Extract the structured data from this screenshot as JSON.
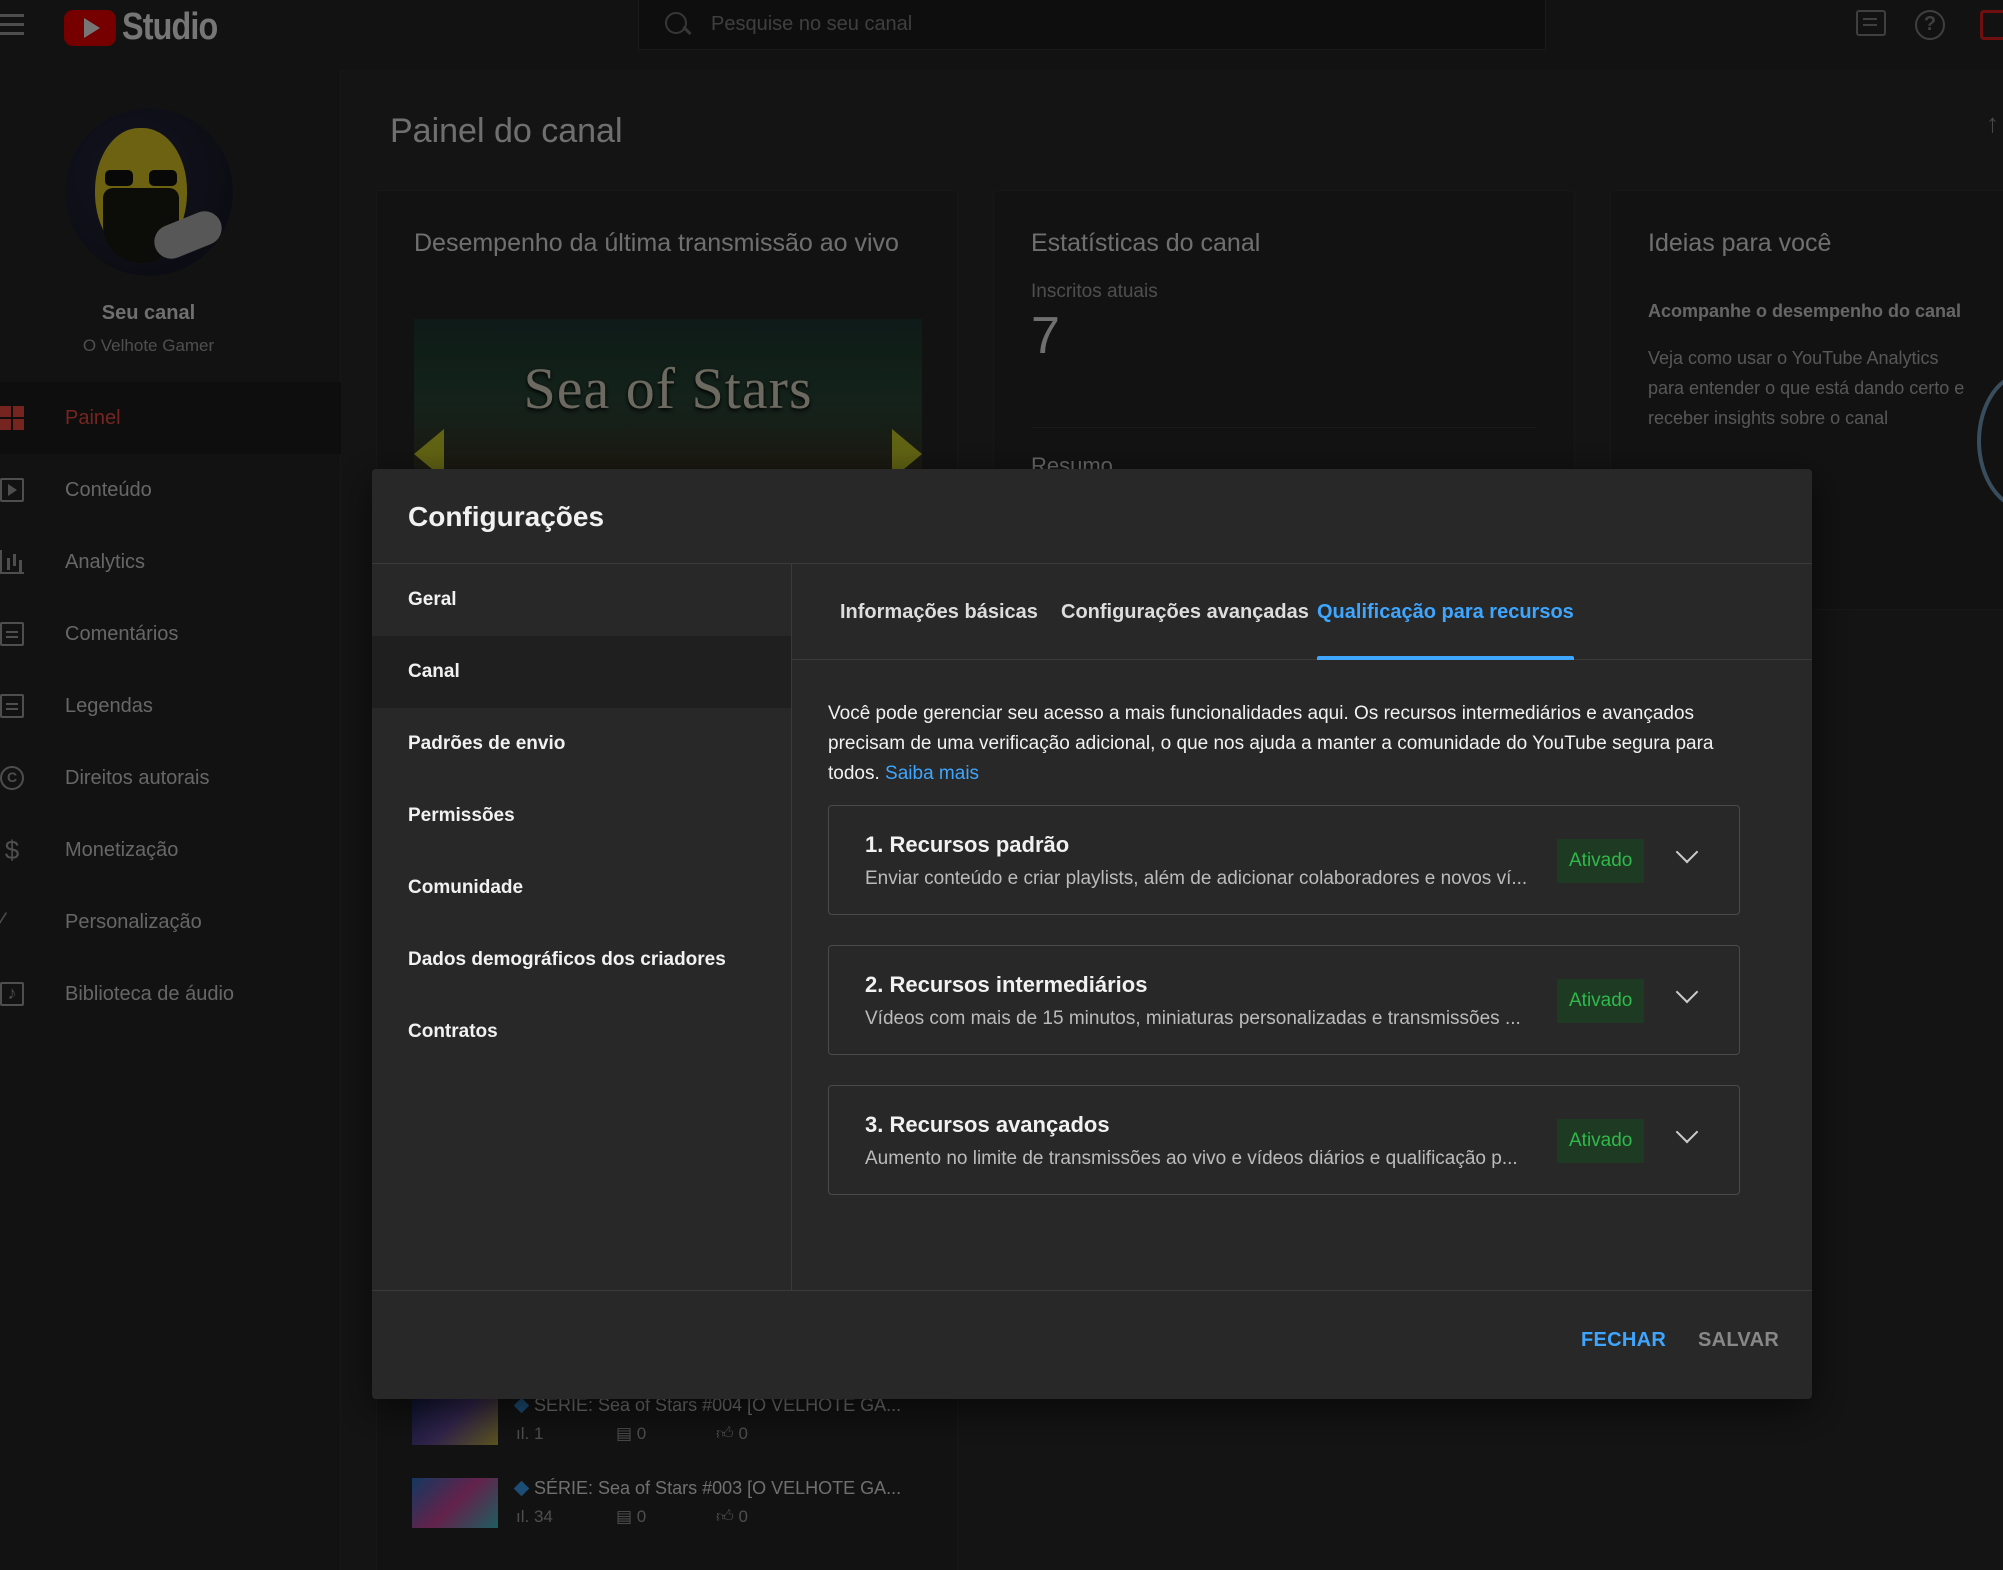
{
  "app": {
    "brand": "Studio"
  },
  "search": {
    "placeholder": "Pesquise no seu canal"
  },
  "channel": {
    "label": "Seu canal",
    "name": "O Velhote Gamer"
  },
  "sidebar": {
    "items": [
      {
        "label": "Painel",
        "icon": "dashboard-icon"
      },
      {
        "label": "Conteúdo",
        "icon": "content-icon"
      },
      {
        "label": "Analytics",
        "icon": "analytics-icon"
      },
      {
        "label": "Comentários",
        "icon": "comments-icon"
      },
      {
        "label": "Legendas",
        "icon": "subtitles-icon"
      },
      {
        "label": "Direitos autorais",
        "icon": "copyright-icon"
      },
      {
        "label": "Monetização",
        "icon": "monetization-icon"
      },
      {
        "label": "Personalização",
        "icon": "customization-icon"
      },
      {
        "label": "Biblioteca de áudio",
        "icon": "audio-library-icon"
      }
    ]
  },
  "main": {
    "title": "Painel do canal",
    "live_card": {
      "title": "Desempenho da última transmissão ao vivo",
      "thumbnail_text": "Sea of Stars"
    },
    "stats_card": {
      "title": "Estatísticas do canal",
      "subscribers_label": "Inscritos atuais",
      "subscribers_value": "7",
      "summary": "Resumo"
    },
    "ideas_card": {
      "title": "Ideias para você",
      "subtitle": "Acompanhe o desempenho do canal",
      "text": "Veja como usar o YouTube Analytics para entender o que está dando certo e receber insights sobre o canal"
    },
    "videos": [
      {
        "title": "SÉRIE: Sea of Stars #004 [O VELHOTE GA...",
        "views": "1",
        "comments": "0",
        "likes": "0"
      },
      {
        "title": "SÉRIE: Sea of Stars #003 [O VELHOTE GA...",
        "views": "34",
        "comments": "0",
        "likes": "0"
      }
    ]
  },
  "modal": {
    "title": "Configurações",
    "nav": [
      "Geral",
      "Canal",
      "Padrões de envio",
      "Permissões",
      "Comunidade",
      "Dados demográficos dos criadores",
      "Contratos"
    ],
    "active_nav": "Canal",
    "tabs": [
      "Informações básicas",
      "Configurações avançadas",
      "Qualificação para recursos"
    ],
    "active_tab": "Qualificação para recursos",
    "intro": "Você pode gerenciar seu acesso a mais funcionalidades aqui. Os recursos intermediários e avançados precisam de uma verificação adicional, o que nos ajuda a manter a comunidade do YouTube segura para todos.",
    "learn_more": "Saiba mais",
    "features": [
      {
        "title": "1. Recursos padrão",
        "desc": "Enviar conteúdo e criar playlists, além de adicionar colaboradores e novos ví...",
        "status": "Ativado"
      },
      {
        "title": "2. Recursos intermediários",
        "desc": "Vídeos com mais de 15 minutos, miniaturas personalizadas e transmissões ...",
        "status": "Ativado"
      },
      {
        "title": "3. Recursos avançados",
        "desc": "Aumento no limite de transmissões ao vivo e vídeos diários e qualificação p...",
        "status": "Ativado"
      }
    ],
    "buttons": {
      "close": "FECHAR",
      "save": "SALVAR"
    }
  },
  "colors": {
    "accent": "#3ea6ff",
    "brand_red": "#ff0000",
    "active_red": "#ff4e45",
    "status_green": "#2fba4a"
  }
}
